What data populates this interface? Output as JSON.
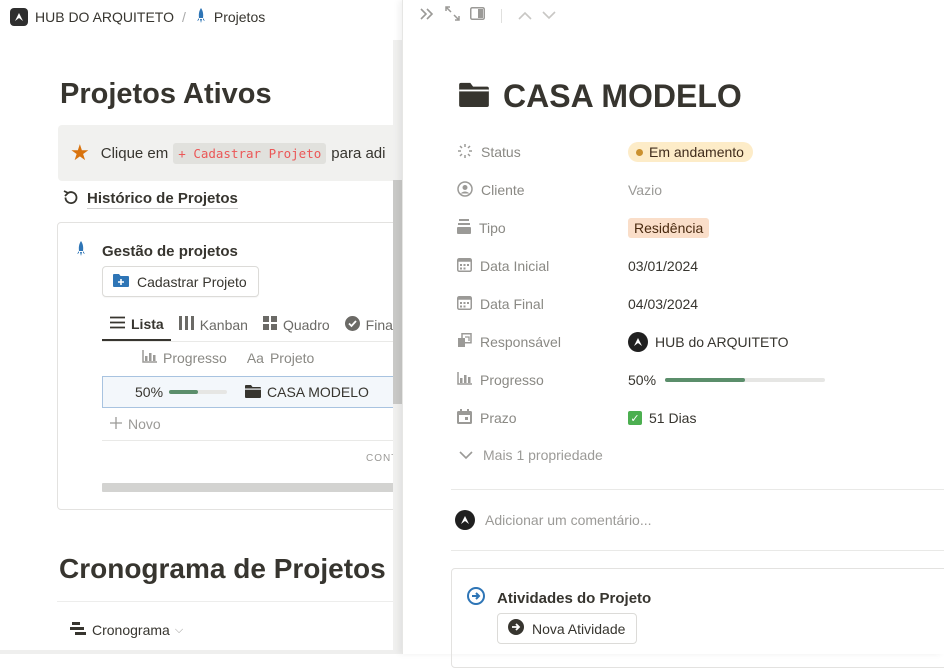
{
  "breadcrumb": {
    "workspace": "HUB DO ARQUITETO",
    "separator": "/",
    "page": "Projetos"
  },
  "left": {
    "title": "Projetos Ativos",
    "callout": {
      "prefix": "Clique em",
      "code": "+ Cadastrar Projeto",
      "suffix": "para adi"
    },
    "history_link": "Histórico de Projetos",
    "database": {
      "title": "Gestão de projetos",
      "add_button": "Cadastrar Projeto",
      "tabs": [
        {
          "label": "Lista",
          "icon": "list-icon"
        },
        {
          "label": "Kanban",
          "icon": "kanban-icon"
        },
        {
          "label": "Quadro",
          "icon": "grid-icon"
        },
        {
          "label": "Fina",
          "icon": "check-circle-icon"
        }
      ],
      "columns": [
        {
          "label": "Progresso",
          "icon": "chart-icon"
        },
        {
          "label": "Projeto",
          "icon": "text-icon",
          "icon_text": "Aa"
        }
      ],
      "rows": [
        {
          "progress_label": "50%",
          "progress": 0.5,
          "name": "CASA MODELO"
        }
      ],
      "new_label": "Novo",
      "calc_label": "CONT"
    },
    "section2_title": "Cronograma de Projetos",
    "timeline_view": "Cronograma"
  },
  "panel": {
    "title": "CASA MODELO",
    "properties": {
      "status": {
        "label": "Status",
        "value": "Em andamento",
        "color": "#fdecc8"
      },
      "cliente": {
        "label": "Cliente",
        "value": "Vazio"
      },
      "tipo": {
        "label": "Tipo",
        "value": "Residência",
        "color": "#fadec9"
      },
      "data_inicial": {
        "label": "Data Inicial",
        "value": "03/01/2024"
      },
      "data_final": {
        "label": "Data Final",
        "value": "04/03/2024"
      },
      "responsavel": {
        "label": "Responsável",
        "value": "HUB do ARQUITETO"
      },
      "progresso": {
        "label": "Progresso",
        "value": "50%",
        "progress": 0.5
      },
      "prazo": {
        "label": "Prazo",
        "value": "51 Dias"
      }
    },
    "more_props": "Mais 1 propriedade",
    "comment_placeholder": "Adicionar um comentário...",
    "activities": {
      "title": "Atividades do Projeto",
      "button": "Nova Atividade"
    }
  },
  "colors": {
    "accent_progress": "#5b8e6b",
    "code_text": "#eb5757",
    "star": "#d9730d"
  }
}
